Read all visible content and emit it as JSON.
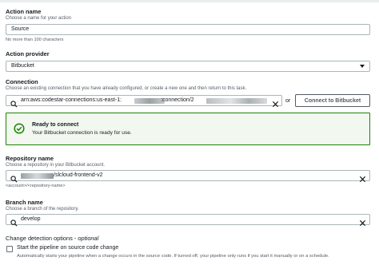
{
  "action_name": {
    "label": "Action name",
    "description": "Choose a name for your action",
    "value": "Source",
    "hint": "No more than 100 characters"
  },
  "action_provider": {
    "label": "Action provider",
    "value": "Bitbucket"
  },
  "connection": {
    "label": "Connection",
    "description": "Choose an existing connection that you have already configured, or create a new one and then return to this task.",
    "value_prefix": "arn:aws:codestar-connections:us-east-1:",
    "value_mid": ":connection/2",
    "or_text": "or",
    "connect_button": "Connect to Bitbucket"
  },
  "alert": {
    "title": "Ready to connect",
    "body": "Your Bitbucket connection is ready for use.",
    "color": "#1d8102"
  },
  "repository": {
    "label": "Repository name",
    "description": "Choose a repository in your Bitbucket account.",
    "value_suffix": "/slcloud-frontend-v2",
    "hint": "<account>/<repository-name>"
  },
  "branch": {
    "label": "Branch name",
    "description": "Choose a branch of the repository.",
    "value": "develop"
  },
  "change_detection": {
    "label": "Change detection options -",
    "optional": "optional",
    "checkbox_label": "Start the pipeline on source code change",
    "checkbox_description": "Automatically starts your pipeline when a change occurs in the source code. If turned off, your pipeline only runs if you start it manually or on a schedule."
  }
}
